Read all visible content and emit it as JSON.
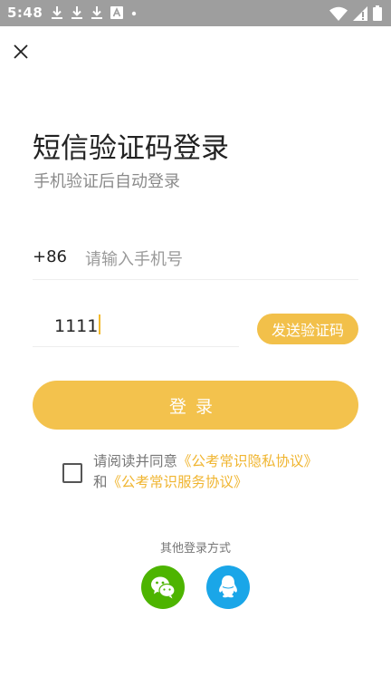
{
  "status_bar": {
    "time": "5:48",
    "left_icons": [
      "download-icon",
      "download-icon",
      "download-icon",
      "a-box-icon",
      "dot-icon"
    ],
    "right_icons": [
      "wifi-icon",
      "signal-icon",
      "battery-icon"
    ]
  },
  "header": {
    "close_icon": "close-icon"
  },
  "title": "短信验证码登录",
  "subtitle": "手机验证后自动登录",
  "phone": {
    "country_code": "+86",
    "placeholder": "请输入手机号",
    "value": ""
  },
  "code": {
    "value": "1111",
    "send_label": "发送验证码"
  },
  "login_button": "登录",
  "agreement": {
    "checked": false,
    "prefix": "请阅读并同意",
    "privacy_link": "《公考常识隐私协议》",
    "conjunction": "和",
    "service_link": "《公考常识服务协议》"
  },
  "other_login": {
    "label": "其他登录方式",
    "providers": [
      {
        "name": "wechat",
        "icon": "wechat-icon",
        "color": "#4db400"
      },
      {
        "name": "qq",
        "icon": "qq-icon",
        "color": "#1aa6e8"
      }
    ]
  },
  "colors": {
    "accent": "#f3c24d",
    "link": "#f0b530",
    "status_bar": "#9e9e9e"
  }
}
